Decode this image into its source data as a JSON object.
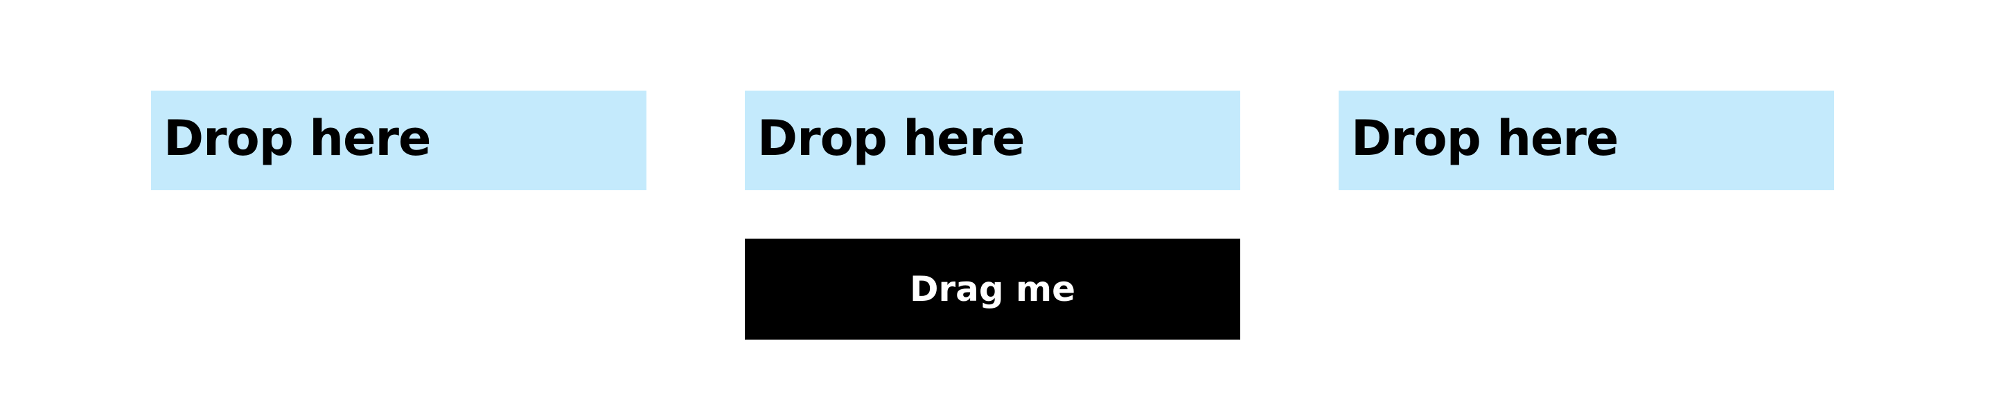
{
  "drop_zones": [
    {
      "label": "Drop here"
    },
    {
      "label": "Drop here"
    },
    {
      "label": "Drop here"
    }
  ],
  "drag_button": {
    "label": "Drag me"
  },
  "colors": {
    "drop_zone_bg": "#c4eafc",
    "drag_button_bg": "#000000",
    "drag_button_text": "#ffffff"
  }
}
